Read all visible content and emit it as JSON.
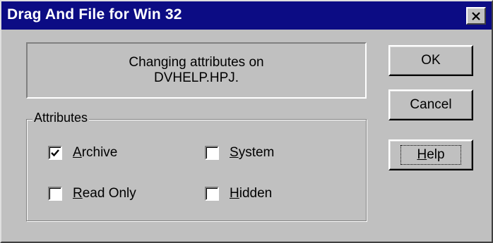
{
  "window": {
    "title": "Drag And File for Win 32",
    "close_icon": "close-icon"
  },
  "message": {
    "line1": "Changing attributes on",
    "line2": "DVHELP.HPJ."
  },
  "attributes": {
    "group_label": "Attributes",
    "items": [
      {
        "key": "A",
        "rest": "rchive",
        "checked": true
      },
      {
        "key": "S",
        "rest": "ystem",
        "checked": false
      },
      {
        "key": "R",
        "rest": "ead Only",
        "checked": false
      },
      {
        "key": "H",
        "rest": "idden",
        "checked": false
      }
    ]
  },
  "buttons": {
    "ok_label": "OK",
    "cancel_label": "Cancel",
    "help_key": "H",
    "help_rest": "elp"
  },
  "colors": {
    "titlebar": "#0c0c84",
    "face": "#c0c0c0"
  }
}
